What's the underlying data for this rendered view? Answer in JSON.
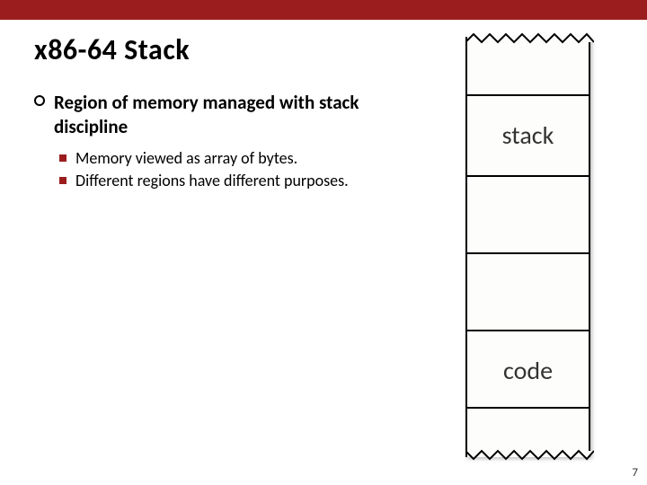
{
  "title": "x86-64 Stack",
  "main_bullet": "Region of memory managed with stack discipline",
  "sub_bullets": [
    "Memory viewed as array of bytes.",
    "Different regions have different purposes."
  ],
  "diagram": {
    "labels": {
      "stack": "stack",
      "code": "code"
    }
  },
  "page_number": "7"
}
